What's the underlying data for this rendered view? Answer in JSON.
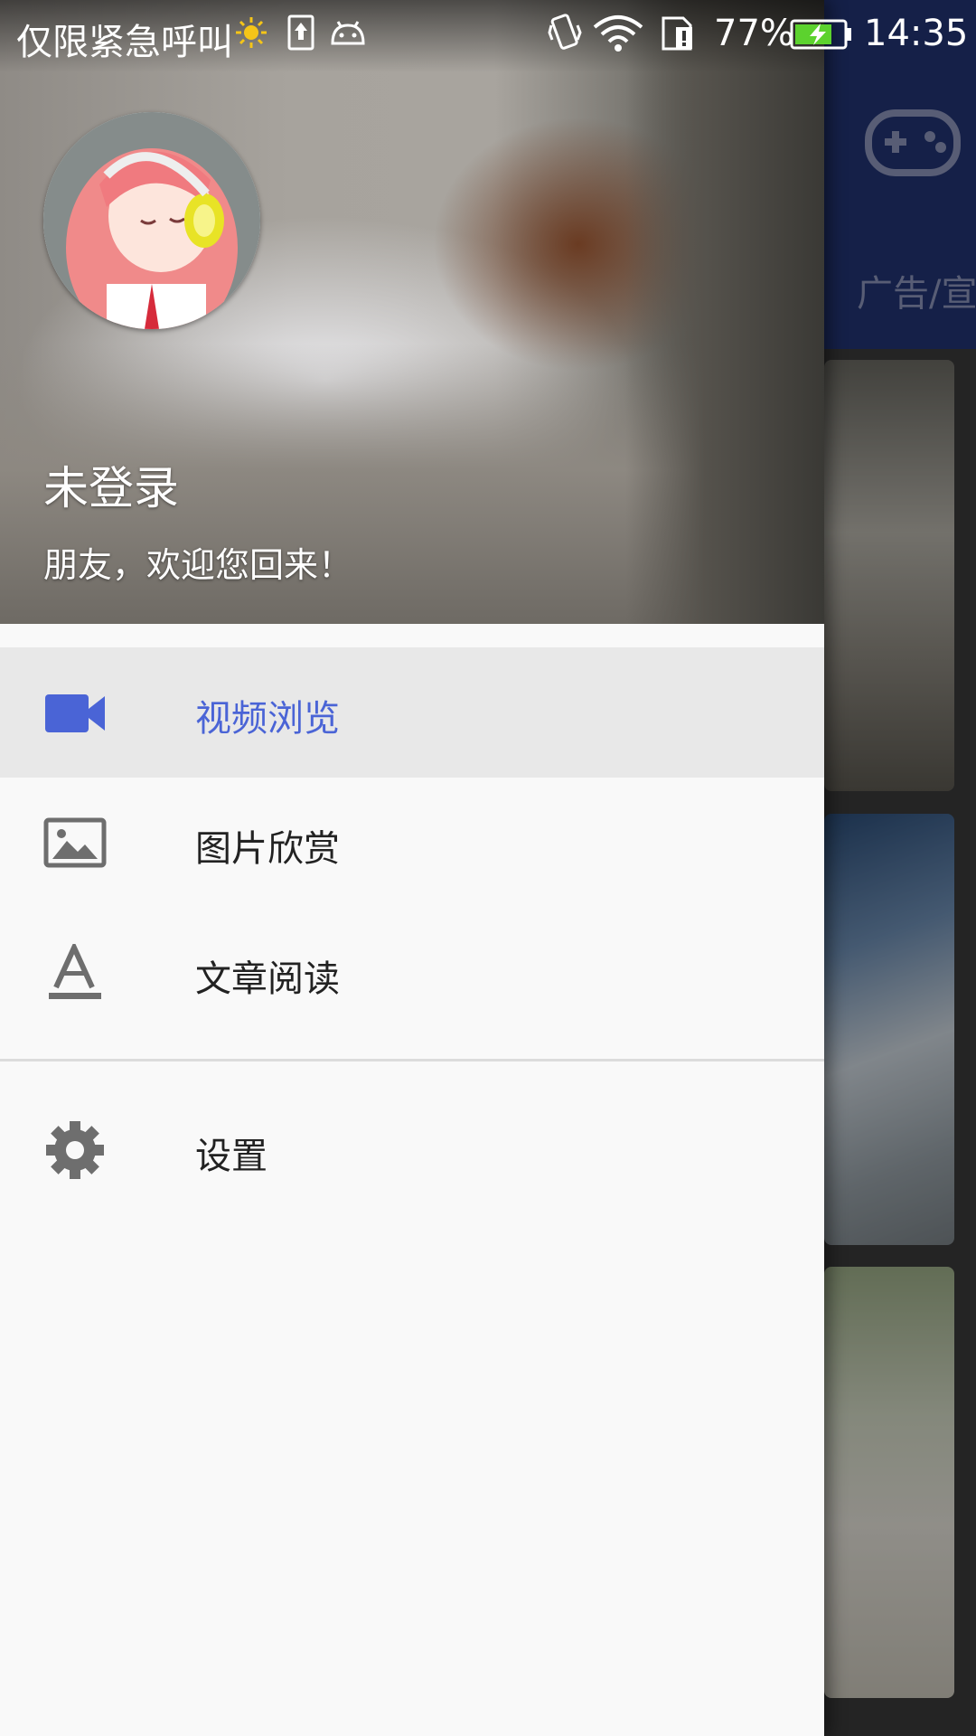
{
  "status_bar": {
    "carrier_text": "仅限紧急呼叫",
    "battery_percent": "77%",
    "time": "14:35",
    "icons": [
      "sun-icon",
      "upload-icon",
      "android-icon",
      "vibrate-icon",
      "wifi-icon",
      "sim-icon",
      "battery-icon"
    ]
  },
  "background_app": {
    "toolbar_color": "#233574",
    "tab_text": "广告/宣",
    "toolbar_icon": "gamepad-icon"
  },
  "drawer": {
    "header": {
      "title": "未登录",
      "subtitle": "朋友，欢迎您回来！",
      "avatar_icon": "anime-avatar"
    },
    "menu": [
      {
        "label": "视频浏览",
        "icon": "videocam-icon",
        "active": true
      },
      {
        "label": "图片欣赏",
        "icon": "image-icon",
        "active": false
      },
      {
        "label": "文章阅读",
        "icon": "text-format-icon",
        "active": false
      }
    ],
    "settings": {
      "label": "设置",
      "icon": "gear-icon"
    }
  },
  "colors": {
    "accent": "#4a64d6",
    "active_row": "#e8e8e8",
    "drawer_bg": "#f9f9f9",
    "icon_gray": "#6e6e6e"
  }
}
